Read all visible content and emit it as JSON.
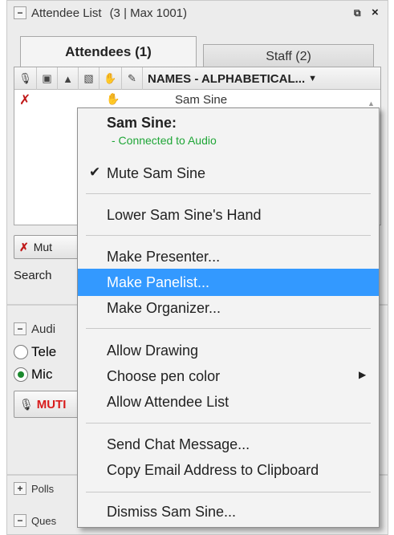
{
  "panel": {
    "title": "Attendee List",
    "count": "(3 | Max 1001)",
    "tabs": [
      {
        "label": "Attendees (1)",
        "active": true
      },
      {
        "label": "Staff (2)",
        "active": false
      }
    ],
    "names_header": "NAMES - ALPHABETICAL...",
    "attendee_name": "Sam Sine",
    "mute_button_label": "Mut",
    "search_label": "Search",
    "audio_section_label": "Audi",
    "telephone_label": "Tele",
    "mic_label": "Mic",
    "muted_label": "MUTI",
    "polls_label": "Polls",
    "questions_label": "Ques"
  },
  "menu": {
    "header_name": "Sam Sine:",
    "status": "- Connected to Audio",
    "items": [
      {
        "label": "Mute Sam Sine",
        "checked": true
      },
      {
        "label": "Lower Sam Sine's Hand"
      },
      {
        "label": "Make Presenter..."
      },
      {
        "label": "Make Panelist...",
        "highlighted": true
      },
      {
        "label": "Make Organizer..."
      },
      {
        "label": "Allow Drawing"
      },
      {
        "label": "Choose pen color",
        "submenu": true
      },
      {
        "label": "Allow Attendee List"
      },
      {
        "label": "Send Chat Message..."
      },
      {
        "label": "Copy Email Address to Clipboard"
      },
      {
        "label": "Dismiss Sam Sine..."
      }
    ]
  },
  "colors": {
    "highlight": "#3399ff",
    "status_green": "#1fa637",
    "muted_red": "#d81b1b"
  }
}
